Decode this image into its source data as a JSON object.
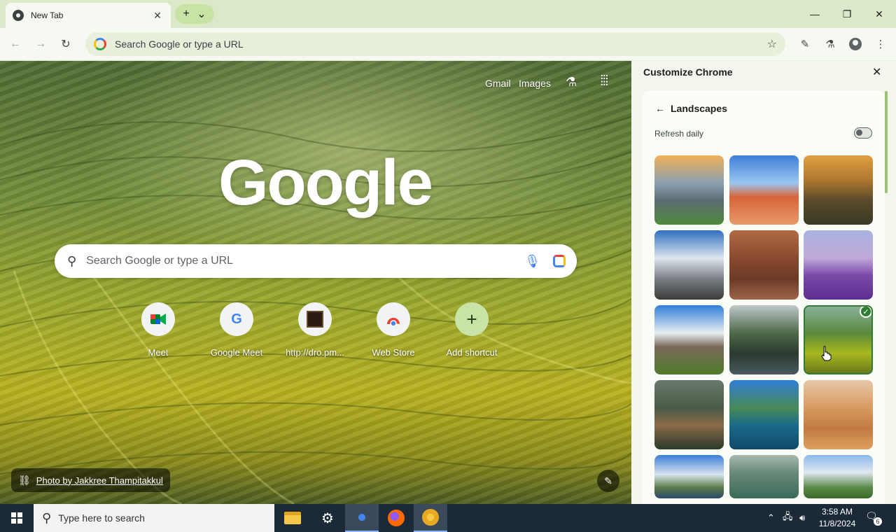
{
  "tab": {
    "title": "New Tab"
  },
  "omnibox": {
    "placeholder": "Search Google or type a URL"
  },
  "ntp": {
    "links": [
      "Gmail",
      "Images"
    ],
    "logo_text": "Google",
    "search_placeholder": "Search Google or type a URL",
    "shortcuts": [
      {
        "label": "Meet",
        "icon": "meet-icon"
      },
      {
        "label": "Google Meet",
        "icon": "google-g-icon"
      },
      {
        "label": "http://dro.pm...",
        "icon": "site-thumbnail-icon"
      },
      {
        "label": "Web Store",
        "icon": "web-store-icon"
      },
      {
        "label": "Add shortcut",
        "icon": "plus-icon"
      }
    ],
    "photo_credit": "Photo by Jakkree Thampitakkul"
  },
  "panel": {
    "title": "Customize Chrome",
    "collection": "Landscapes",
    "refresh_label": "Refresh daily",
    "refresh_on": false,
    "thumbnails": [
      {
        "name": "rocky-lake-sunset",
        "selected": false
      },
      {
        "name": "desert-arch",
        "selected": false
      },
      {
        "name": "canyon-sunset",
        "selected": false
      },
      {
        "name": "snowy-mountain",
        "selected": false
      },
      {
        "name": "red-canyon",
        "selected": false
      },
      {
        "name": "lavender-field",
        "selected": false
      },
      {
        "name": "volcano-mist",
        "selected": false
      },
      {
        "name": "mountain-lake-reflection",
        "selected": false
      },
      {
        "name": "rice-terraces",
        "selected": true
      },
      {
        "name": "stone-bridge",
        "selected": false
      },
      {
        "name": "turquoise-lake",
        "selected": false
      },
      {
        "name": "desert-dunes",
        "selected": false
      },
      {
        "name": "coastal-cliffs",
        "selected": false
      },
      {
        "name": "misty-forest",
        "selected": false
      },
      {
        "name": "green-valley",
        "selected": false
      }
    ]
  },
  "taskbar": {
    "search_placeholder": "Type here to search",
    "time": "3:58 AM",
    "date": "11/8/2024",
    "notification_count": "6",
    "apps": [
      "file-explorer",
      "settings",
      "chrome",
      "firefox",
      "chrome-canary"
    ]
  }
}
